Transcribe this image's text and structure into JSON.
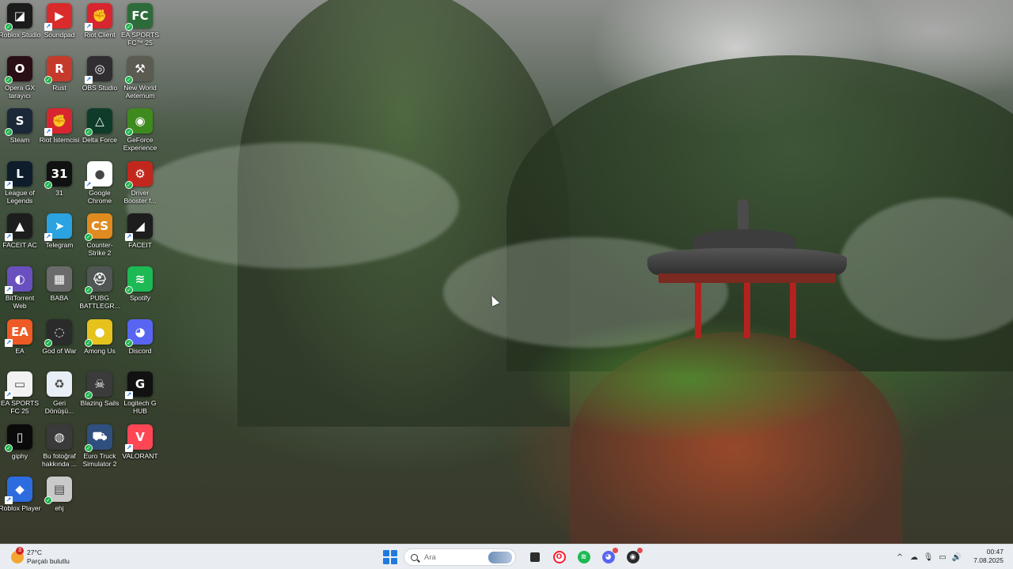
{
  "desktop": {
    "icons": [
      {
        "label": "Roblox Studio",
        "icon": "roblox-studio-icon",
        "color": "#1b1b1b",
        "glyph": "◪",
        "badge": "check"
      },
      {
        "label": "Soundpad",
        "icon": "soundpad-icon",
        "color": "#d92b2b",
        "glyph": "▶",
        "badge": "arrow"
      },
      {
        "label": "Riot Client",
        "icon": "riot-client-icon",
        "color": "#d7262f",
        "glyph": "✊",
        "badge": "arrow"
      },
      {
        "label": "EA SPORTS FC™ 25",
        "icon": "ea-sports-fc-icon",
        "color": "#2e6b3a",
        "glyph": "FC",
        "badge": "check"
      },
      {
        "label": "Opera GX tarayıcı",
        "icon": "opera-gx-icon",
        "color": "#2a0f17",
        "glyph": "O",
        "badge": "check"
      },
      {
        "label": "Rust",
        "icon": "rust-icon",
        "color": "#c43b2c",
        "glyph": "R",
        "badge": "check"
      },
      {
        "label": "OBS Studio",
        "icon": "obs-studio-icon",
        "color": "#302e31",
        "glyph": "◎",
        "badge": "arrow"
      },
      {
        "label": "New World Aeternum",
        "icon": "new-world-icon",
        "color": "#5b5b52",
        "glyph": "⚒",
        "badge": "check"
      },
      {
        "label": "Steam",
        "icon": "steam-icon",
        "color": "#1b2838",
        "glyph": "S",
        "badge": "check"
      },
      {
        "label": "Riot İstemcisi",
        "icon": "riot-istemcisi-icon",
        "color": "#d7262f",
        "glyph": "✊",
        "badge": "arrow"
      },
      {
        "label": "Delta Force",
        "icon": "delta-force-icon",
        "color": "#0f3b2a",
        "glyph": "△",
        "badge": "check"
      },
      {
        "label": "GeForce Experience",
        "icon": "geforce-icon",
        "color": "#3f8a1f",
        "glyph": "◉",
        "badge": "check"
      },
      {
        "label": "League of Legends",
        "icon": "league-of-legends-icon",
        "color": "#0d1d2c",
        "glyph": "L",
        "badge": "arrow"
      },
      {
        "label": "31",
        "icon": "calendar-31-icon",
        "color": "#111111",
        "glyph": "31",
        "badge": "check"
      },
      {
        "label": "Google Chrome",
        "icon": "chrome-icon",
        "color": "#ffffff",
        "glyph": "●",
        "badge": "arrow"
      },
      {
        "label": "Driver Booster f...",
        "icon": "driver-booster-icon",
        "color": "#c2271d",
        "glyph": "⚙",
        "badge": "check"
      },
      {
        "label": "FACEIT AC",
        "icon": "faceit-ac-icon",
        "color": "#1d1d1d",
        "glyph": "▲",
        "badge": "arrow"
      },
      {
        "label": "Telegram",
        "icon": "telegram-icon",
        "color": "#2aa3e0",
        "glyph": "➤",
        "badge": "arrow"
      },
      {
        "label": "Counter-Strike 2",
        "icon": "counter-strike-icon",
        "color": "#e08b1f",
        "glyph": "CS",
        "badge": "check"
      },
      {
        "label": "FACEIT",
        "icon": "faceit-icon",
        "color": "#1d1d1d",
        "glyph": "◢",
        "badge": "arrow"
      },
      {
        "label": "BitTorrent Web",
        "icon": "bittorrent-icon",
        "color": "#6a4fbf",
        "glyph": "◐",
        "badge": "arrow"
      },
      {
        "label": "BABA",
        "icon": "baba-folder-icon",
        "color": "#6a6a6a",
        "glyph": "▦",
        "badge": "none"
      },
      {
        "label": "PUBG BATTLEGR...",
        "icon": "pubg-icon",
        "color": "#4f5654",
        "glyph": "⛑",
        "badge": "check"
      },
      {
        "label": "Spotify",
        "icon": "spotify-icon",
        "color": "#1db954",
        "glyph": "≋",
        "badge": "check"
      },
      {
        "label": "EA",
        "icon": "ea-icon",
        "color": "#ee5a24",
        "glyph": "EA",
        "badge": "arrow"
      },
      {
        "label": "God of War",
        "icon": "god-of-war-icon",
        "color": "#2b2b2b",
        "glyph": "◌",
        "badge": "check"
      },
      {
        "label": "Among Us",
        "icon": "among-us-icon",
        "color": "#e5c21c",
        "glyph": "●",
        "badge": "check"
      },
      {
        "label": "Discord",
        "icon": "discord-icon",
        "color": "#5865f2",
        "glyph": "◕",
        "badge": "check"
      },
      {
        "label": "EA SPORTS FC 25",
        "icon": "file-icon",
        "color": "#f2f2f2",
        "glyph": "▭",
        "badge": "arrow"
      },
      {
        "label": "Geri Dönüşü...",
        "icon": "recycle-bin-icon",
        "color": "#e8eef5",
        "glyph": "♻",
        "badge": "none"
      },
      {
        "label": "Blazing Sails",
        "icon": "blazing-sails-icon",
        "color": "#3b3b3b",
        "glyph": "☠",
        "badge": "check"
      },
      {
        "label": "Logitech G HUB",
        "icon": "logitech-ghub-icon",
        "color": "#111111",
        "glyph": "G",
        "badge": "arrow"
      },
      {
        "label": "giphy",
        "icon": "giphy-icon",
        "color": "#0a0a0a",
        "glyph": "▯",
        "badge": "check"
      },
      {
        "label": "Bu fotoğraf hakkında ...",
        "icon": "about-photo-icon",
        "color": "#3a3a3a",
        "glyph": "◍",
        "badge": "none"
      },
      {
        "label": "Euro Truck Simulator 2",
        "icon": "euro-truck-icon",
        "color": "#2f4f7f",
        "glyph": "⛟",
        "badge": "check"
      },
      {
        "label": "VALORANT",
        "icon": "valorant-icon",
        "color": "#ff4655",
        "glyph": "V",
        "badge": "arrow"
      },
      {
        "label": "Roblox Player",
        "icon": "roblox-player-icon",
        "color": "#2d6cdf",
        "glyph": "◆",
        "badge": "arrow"
      },
      {
        "label": "ehj",
        "icon": "archive-file-icon",
        "color": "#c9c9c9",
        "glyph": "▤",
        "badge": "check"
      }
    ]
  },
  "taskbar": {
    "weather": {
      "temp": "27°C",
      "condition": "Parçalı bulutlu",
      "badge": "3"
    },
    "search": {
      "placeholder": "Ara"
    },
    "apps": [
      {
        "name": "file-explorer",
        "icon": "file-explorer-icon",
        "color": "#2d2d2d",
        "glyph": "▮"
      },
      {
        "name": "opera",
        "icon": "opera-icon",
        "color": "#ff1b2d",
        "glyph": "O"
      },
      {
        "name": "spotify",
        "icon": "spotify-icon",
        "color": "#1db954",
        "glyph": "≋"
      },
      {
        "name": "discord",
        "icon": "discord-icon",
        "color": "#5865f2",
        "glyph": "◕"
      },
      {
        "name": "app-black",
        "icon": "generic-app-icon",
        "color": "#2b2b2b",
        "glyph": "◉"
      }
    ],
    "tray": {
      "chevron": "^",
      "onedrive": "☁",
      "mic": "🎙",
      "network": "▭",
      "volume": "🔊"
    },
    "clock": {
      "time": "00:47",
      "date": "7.08.2025"
    }
  }
}
